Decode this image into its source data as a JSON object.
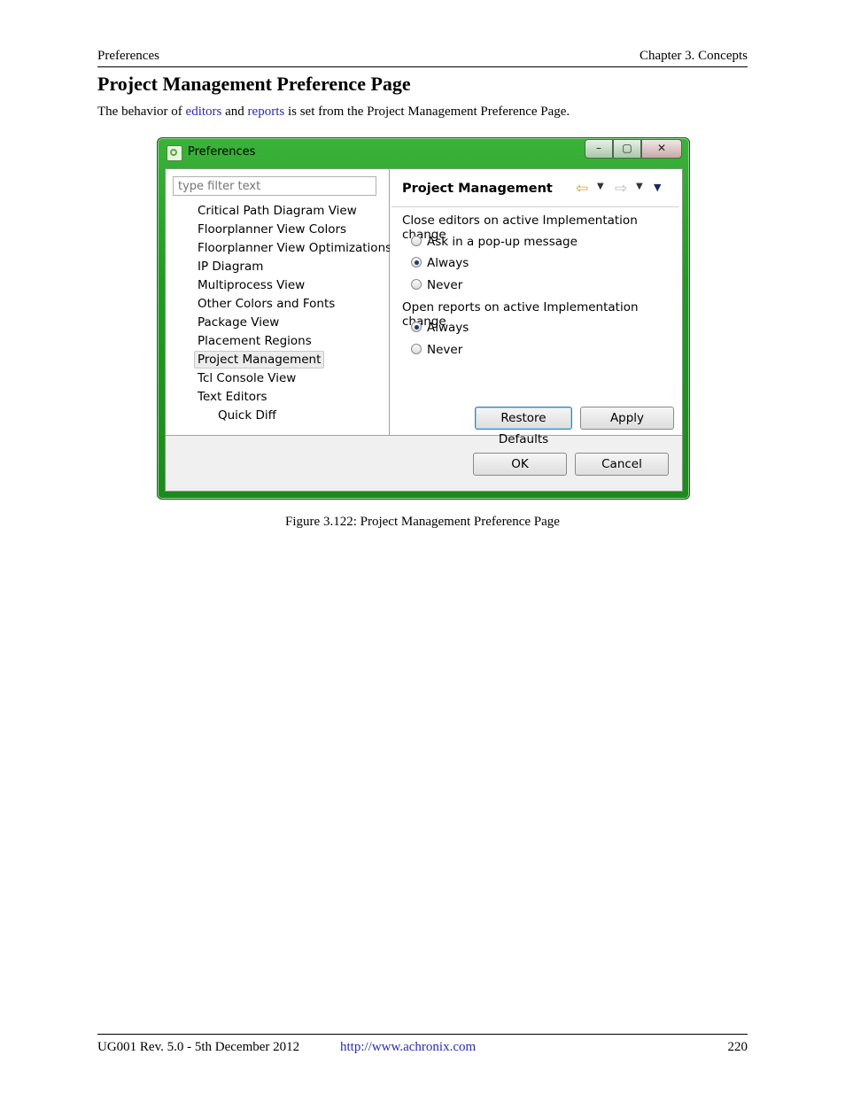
{
  "header": {
    "left": "Preferences",
    "right": "Chapter 3. Concepts"
  },
  "section_title": "Project Management Preference Page",
  "intro": {
    "pre": "The behavior of ",
    "link1": "editors",
    "mid": " and ",
    "link2": "reports",
    "post": " is set from the Project Management Preference Page."
  },
  "window": {
    "title": "Preferences",
    "controls": {
      "minimize": "–",
      "maximize": "▢",
      "close": "✕"
    },
    "filter_placeholder": "type filter text",
    "tree": [
      "Critical Path Diagram View",
      "Floorplanner View Colors",
      "Floorplanner View Optimizations",
      "IP Diagram",
      "Multiprocess View",
      "Other Colors and Fonts",
      "Package View",
      "Placement Regions",
      "Project Management",
      "Tcl Console View",
      "Text Editors",
      "Quick Diff"
    ],
    "selected_item": "Project Management",
    "page_title": "Project Management",
    "group1": {
      "label": "Close editors on active Implementation change",
      "options": [
        "Ask in a pop-up message",
        "Always",
        "Never"
      ],
      "selected": "Always"
    },
    "group2": {
      "label": "Open reports on active Implementation change",
      "options": [
        "Always",
        "Never"
      ],
      "selected": "Always"
    },
    "buttons": {
      "restore": "Restore Defaults",
      "apply": "Apply",
      "ok": "OK",
      "cancel": "Cancel"
    }
  },
  "caption": "Figure 3.122: Project Management Preference Page",
  "footer": {
    "left": "UG001 Rev. 5.0 - 5th December 2012",
    "link": "http://www.achronix.com",
    "page": "220"
  }
}
